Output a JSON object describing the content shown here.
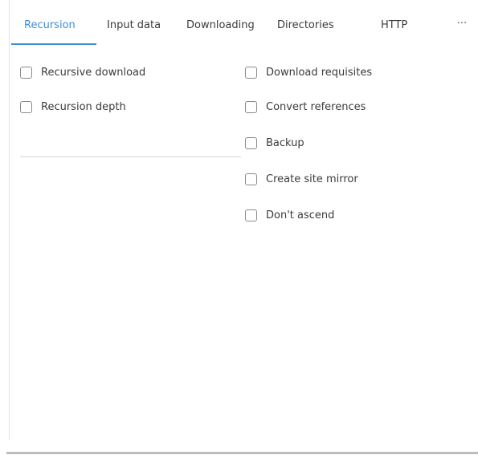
{
  "tabs": [
    {
      "label": "Recursion",
      "active": true
    },
    {
      "label": "Input data",
      "active": false
    },
    {
      "label": "Downloading",
      "active": false
    },
    {
      "label": "Directories",
      "active": false
    },
    {
      "label": "HTTP",
      "active": false
    }
  ],
  "more_label": "···",
  "recursion": {
    "left_options": [
      {
        "label": "Recursive download",
        "checked": false
      },
      {
        "label": "Recursion depth",
        "checked": false
      }
    ],
    "depth_value": "",
    "right_options": [
      {
        "label": "Download requisites",
        "checked": false
      },
      {
        "label": "Convert references",
        "checked": false
      },
      {
        "label": "Backup",
        "checked": false
      },
      {
        "label": "Create site mirror",
        "checked": false
      },
      {
        "label": "Don't ascend",
        "checked": false
      }
    ]
  },
  "colors": {
    "accent": "#3d8ed6",
    "text": "#3b3b3b",
    "checkbox_border": "#8a8a8a"
  }
}
